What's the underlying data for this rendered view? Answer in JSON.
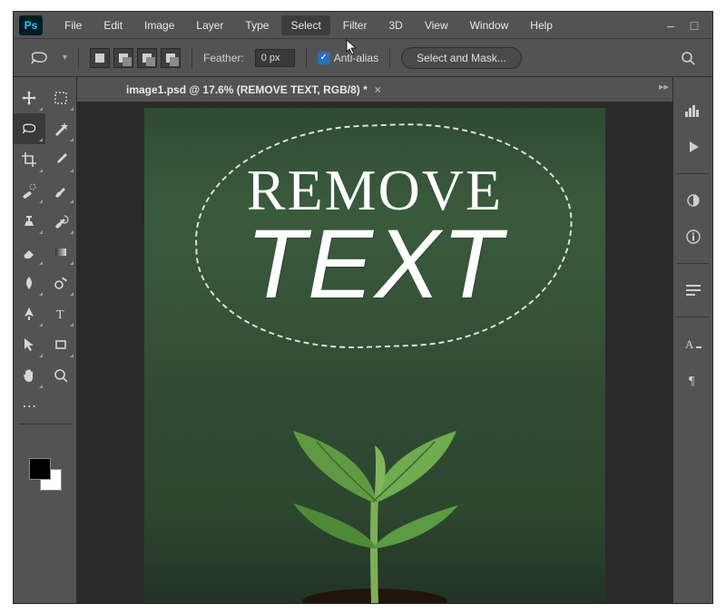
{
  "app": {
    "name": "Ps"
  },
  "menubar": {
    "items": [
      "File",
      "Edit",
      "Image",
      "Layer",
      "Type",
      "Select",
      "Filter",
      "3D",
      "View",
      "Window",
      "Help"
    ],
    "highlighted_index": 5
  },
  "window_controls": {
    "minimize": "–",
    "maximize": "□",
    "close": "×"
  },
  "optionsbar": {
    "feather_label": "Feather:",
    "feather_value": "0 px",
    "anti_alias_label": "Anti-alias",
    "anti_alias_checked": true,
    "select_mask_label": "Select and Mask..."
  },
  "document": {
    "tab_label": "image1.psd @ 17.6% (REMOVE TEXT, RGB/8) *",
    "canvas_text_line1": "REMOVE",
    "canvas_text_line2": "TEXT"
  },
  "tools": {
    "left": [
      "move-tool",
      "marquee-tool",
      "lasso-tool",
      "magic-wand-tool",
      "crop-tool",
      "eyedropper-tool",
      "spot-healing-brush-tool",
      "brush-tool",
      "clone-stamp-tool",
      "history-brush-tool",
      "eraser-tool",
      "gradient-tool",
      "blur-tool",
      "dodge-tool",
      "pen-tool",
      "type-tool",
      "path-selection-tool",
      "rectangle-tool",
      "hand-tool",
      "zoom-tool"
    ],
    "selected": "lasso-tool"
  },
  "right_dock": {
    "icons": [
      "histogram-icon",
      "play-icon",
      "adjustments-icon",
      "info-icon",
      "paragraph-styles-icon",
      "character-icon",
      "glyphs-icon"
    ]
  },
  "colors": {
    "accent": "#31c5f0",
    "bg": "#535353"
  }
}
